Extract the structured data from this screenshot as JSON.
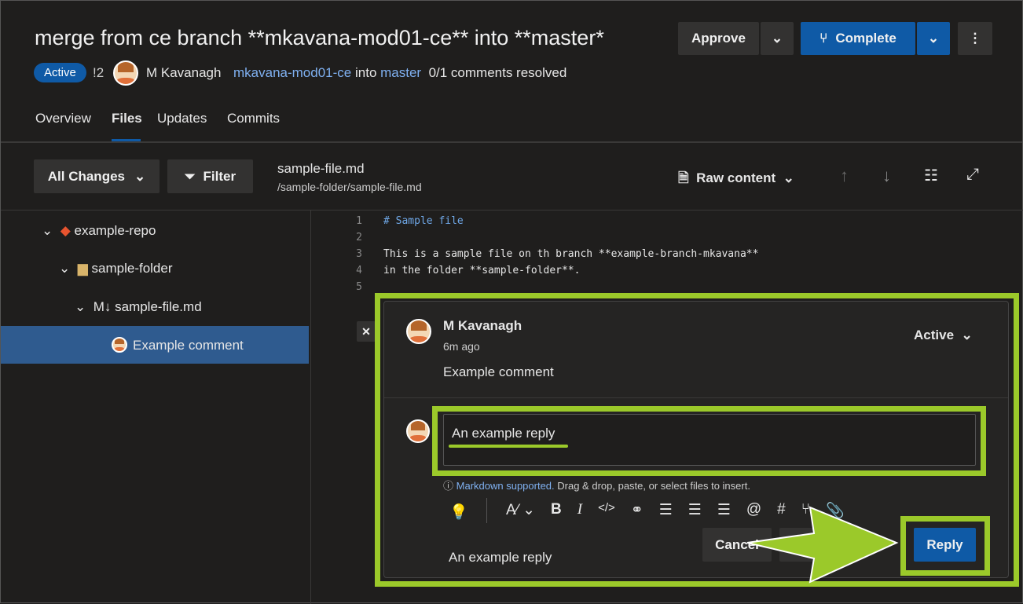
{
  "header": {
    "title": "merge from ce branch **mkavana-mod01-ce** into **master*",
    "status": "Active",
    "count": "!2",
    "author": "M Kavanagh",
    "source_branch": "mkavana-mod01-ce",
    "into": "into",
    "target_branch": "master",
    "comments_resolved": "0/1 comments resolved",
    "approve_label": "Approve",
    "complete_label": "Complete",
    "more_icon": "more-vertical-icon"
  },
  "tabs": [
    {
      "label": "Overview"
    },
    {
      "label": "Files",
      "active": true
    },
    {
      "label": "Updates"
    },
    {
      "label": "Commits"
    }
  ],
  "toolbar": {
    "changes_label": "All Changes",
    "filter_label": "Filter",
    "file_name": "sample-file.md",
    "file_path": "/sample-folder/sample-file.md",
    "view_label": "Raw content"
  },
  "tree": {
    "repo": "example-repo",
    "folder": "sample-folder",
    "file_prefix": "M↓",
    "file": "sample-file.md",
    "comment": "Example comment"
  },
  "code": [
    {
      "n": "1",
      "text": "# Sample file"
    },
    {
      "n": "2",
      "text": ""
    },
    {
      "n": "3",
      "text": "This is a sample file on th branch **example-branch-mkavana**"
    },
    {
      "n": "4",
      "text": "in the folder **sample-folder**."
    },
    {
      "n": "5",
      "text": ""
    }
  ],
  "comment": {
    "author": "M Kavanagh",
    "time": "6m ago",
    "status": "Active",
    "body": "Example comment",
    "reply_value": "An example reply",
    "markdown_link": "Markdown supported.",
    "markdown_hint": " Drag & drop, paste, or select files to insert.",
    "preview": "An example reply",
    "cancel_label": "Cancel",
    "reply_label": "Reply"
  },
  "colors": {
    "accent": "#0f5aa6",
    "highlight": "#9bc92a",
    "selected": "#2f5b8f"
  }
}
